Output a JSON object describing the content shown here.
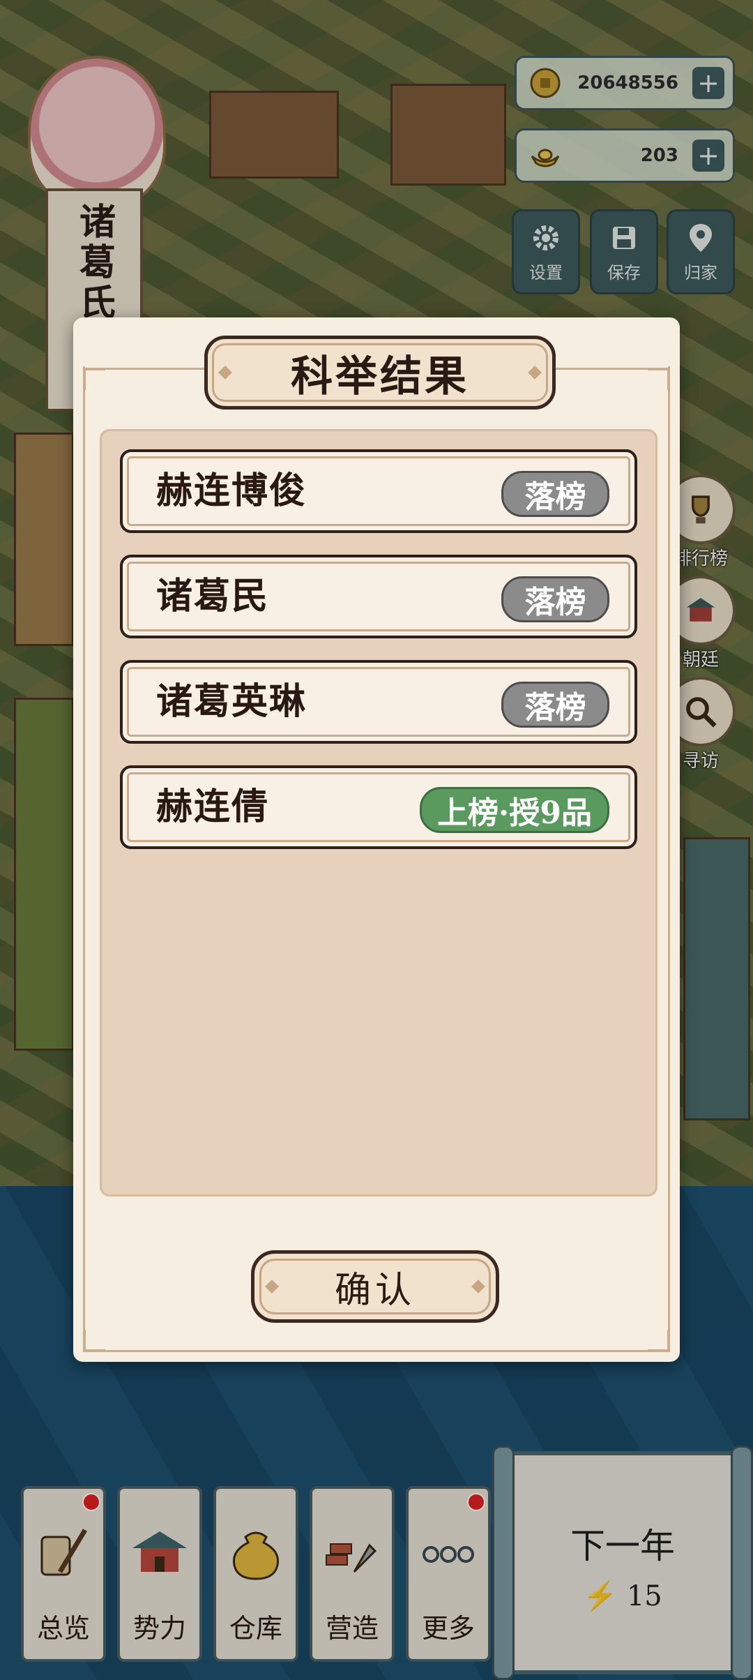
{
  "resources": {
    "coins": "20648556",
    "gold": "203"
  },
  "system_buttons": {
    "settings": "设置",
    "save": "保存",
    "home": "归家"
  },
  "character": {
    "name": "诸葛氏"
  },
  "side_buttons": {
    "ranking": "排行榜",
    "court": "朝廷",
    "visit": "寻访"
  },
  "dialog": {
    "title": "科举结果",
    "results": [
      {
        "name": "赫连博俊",
        "status": "落榜",
        "passed": false
      },
      {
        "name": "诸葛民",
        "status": "落榜",
        "passed": false
      },
      {
        "name": "诸葛英琳",
        "status": "落榜",
        "passed": false
      },
      {
        "name": "赫连倩",
        "status": "上榜·授9品",
        "passed": true
      }
    ],
    "confirm": "确认"
  },
  "bottom_nav": {
    "items": [
      {
        "label": "总览",
        "badge": true
      },
      {
        "label": "势力",
        "badge": false
      },
      {
        "label": "仓库",
        "badge": false
      },
      {
        "label": "营造",
        "badge": false
      },
      {
        "label": "更多",
        "badge": true
      }
    ],
    "next_year": "下一年",
    "energy": "15"
  },
  "colors": {
    "fail_badge": "#8b8b8b",
    "pass_badge": "#5a9a5e",
    "panel": "#f6eee0"
  }
}
